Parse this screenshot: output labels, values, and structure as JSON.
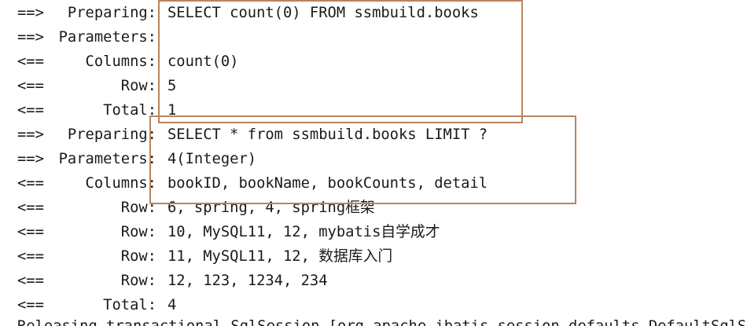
{
  "log": {
    "lines": [
      {
        "arrow": "==>",
        "label": "Preparing:",
        "content": "SELECT count(0) FROM ssmbuild.books"
      },
      {
        "arrow": "==>",
        "label": "Parameters:",
        "content": ""
      },
      {
        "arrow": "<==",
        "label": "Columns:",
        "content": "count(0)"
      },
      {
        "arrow": "<==",
        "label": "Row:",
        "content": "5"
      },
      {
        "arrow": "<==",
        "label": "Total:",
        "content": "1"
      },
      {
        "arrow": "==>",
        "label": "Preparing:",
        "content": "SELECT * from ssmbuild.books LIMIT ?"
      },
      {
        "arrow": "==>",
        "label": "Parameters:",
        "content": "4(Integer)"
      },
      {
        "arrow": "<==",
        "label": "Columns:",
        "content": "bookID, bookName, bookCounts, detail"
      },
      {
        "arrow": "<==",
        "label": "Row:",
        "content": "6, spring, 4, spring框架"
      },
      {
        "arrow": "<==",
        "label": "Row:",
        "content": "10, MySQL11, 12, mybatis自学成才"
      },
      {
        "arrow": "<==",
        "label": "Row:",
        "content": "11, MySQL11, 12, 数据库入门"
      },
      {
        "arrow": "<==",
        "label": "Row:",
        "content": "12, 123, 1234, 234"
      },
      {
        "arrow": "<==",
        "label": "Total:",
        "content": "4"
      }
    ],
    "cut_line": "Releasing transactional SqlSession [org.apache.ibatis.session.defaults.DefaultSqlSession"
  },
  "highlight_color": "#b8845e"
}
